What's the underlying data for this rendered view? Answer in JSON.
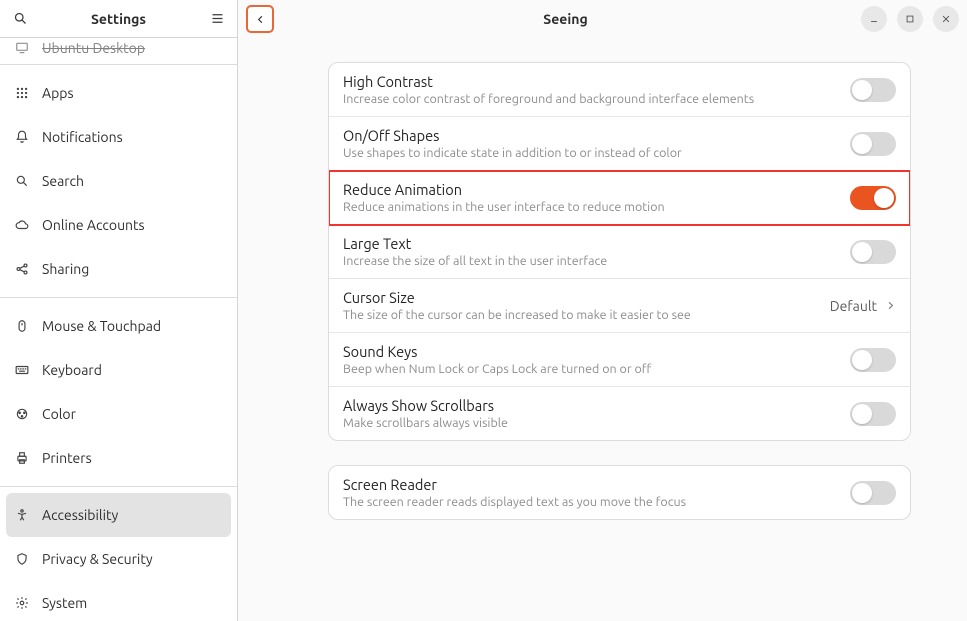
{
  "sidebar": {
    "title": "Settings",
    "partial_item": {
      "label": "Ubuntu Desktop"
    },
    "items1": [
      {
        "label": "Apps",
        "icon": "apps"
      },
      {
        "label": "Notifications",
        "icon": "bell"
      },
      {
        "label": "Search",
        "icon": "search"
      },
      {
        "label": "Online Accounts",
        "icon": "cloud"
      },
      {
        "label": "Sharing",
        "icon": "share"
      }
    ],
    "items2": [
      {
        "label": "Mouse & Touchpad",
        "icon": "mouse"
      },
      {
        "label": "Keyboard",
        "icon": "keyboard"
      },
      {
        "label": "Color",
        "icon": "color"
      },
      {
        "label": "Printers",
        "icon": "printer"
      }
    ],
    "items3": [
      {
        "label": "Accessibility",
        "icon": "accessibility",
        "active": true
      },
      {
        "label": "Privacy & Security",
        "icon": "privacy"
      },
      {
        "label": "System",
        "icon": "gear"
      }
    ]
  },
  "header": {
    "title": "Seeing"
  },
  "seeing": {
    "options": [
      {
        "title": "High Contrast",
        "desc": "Increase color contrast of foreground and background interface elements",
        "type": "toggle",
        "on": false
      },
      {
        "title": "On/Off Shapes",
        "desc": "Use shapes to indicate state in addition to or instead of color",
        "type": "toggle",
        "on": false
      },
      {
        "title": "Reduce Animation",
        "desc": "Reduce animations in the user interface to reduce motion",
        "type": "toggle",
        "on": true,
        "highlight": true
      },
      {
        "title": "Large Text",
        "desc": "Increase the size of all text in the user interface",
        "type": "toggle",
        "on": false
      },
      {
        "title": "Cursor Size",
        "desc": "The size of the cursor can be increased to make it easier to see",
        "type": "link",
        "value": "Default"
      },
      {
        "title": "Sound Keys",
        "desc": "Beep when Num Lock or Caps Lock are turned on or off",
        "type": "toggle",
        "on": false
      },
      {
        "title": "Always Show Scrollbars",
        "desc": "Make scrollbars always visible",
        "type": "toggle",
        "on": false
      }
    ],
    "screen_reader": {
      "title": "Screen Reader",
      "desc": "The screen reader reads displayed text as you move the focus",
      "on": false
    }
  },
  "colors": {
    "accent": "#e95420",
    "highlight_border": "#f0352c"
  }
}
